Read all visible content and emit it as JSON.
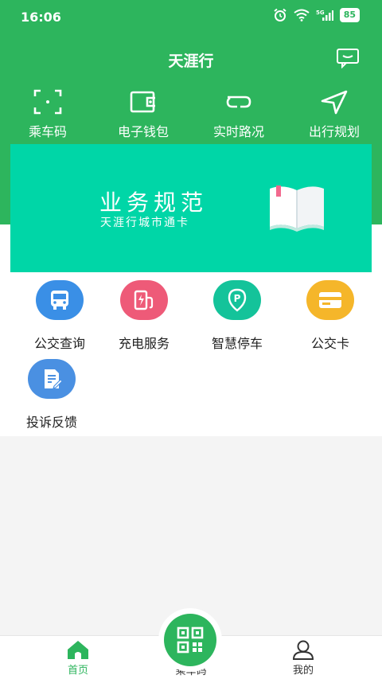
{
  "status_bar": {
    "time": "16:06",
    "battery": "85"
  },
  "app": {
    "title": "天涯行"
  },
  "quick_actions": [
    {
      "label": "乘车码",
      "icon": "scan-icon"
    },
    {
      "label": "电子钱包",
      "icon": "wallet-icon"
    },
    {
      "label": "实时路况",
      "icon": "route-icon"
    },
    {
      "label": "出行规划",
      "icon": "navigation-icon"
    }
  ],
  "banner": {
    "title": "业务规范",
    "subtitle": "天涯行城市通卡",
    "icon": "book-icon"
  },
  "services": [
    {
      "label": "公交查询",
      "icon": "bus-icon",
      "color": "#3a8fe6"
    },
    {
      "label": "充电服务",
      "icon": "charging-icon",
      "color": "#ee5a78"
    },
    {
      "label": "智慧停车",
      "icon": "parking-icon",
      "color": "#14c39a"
    },
    {
      "label": "公交卡",
      "icon": "card-icon",
      "color": "#f5b62a"
    },
    {
      "label": "投诉反馈",
      "icon": "feedback-icon",
      "color": "#4a90e2"
    }
  ],
  "bottom_nav": [
    {
      "label": "首页",
      "icon": "home-icon",
      "active": true
    },
    {
      "label": "乘车码",
      "icon": "qr-code-icon",
      "active": false
    },
    {
      "label": "我的",
      "icon": "profile-icon",
      "active": false
    }
  ],
  "colors": {
    "brand_green": "#2db55d",
    "banner_teal": "#00d6a7",
    "nav_inactive": "#333333"
  }
}
